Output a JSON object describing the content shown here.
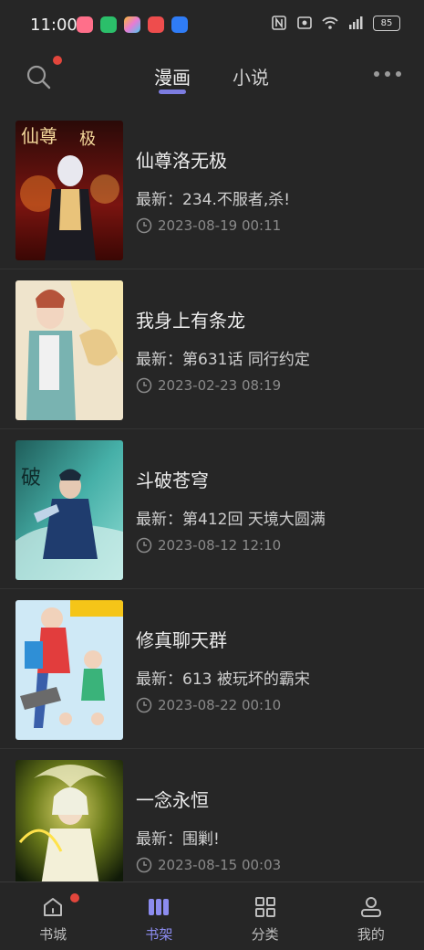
{
  "status_bar": {
    "time": "11:00",
    "battery": "85",
    "network": "5G",
    "app_icons": [
      {
        "name": "app-bilibili-icon",
        "color": "#ff6f8a"
      },
      {
        "name": "app-chat-icon",
        "color": "#2bbf6a"
      },
      {
        "name": "app-photos-icon",
        "color": "#e77bd4"
      },
      {
        "name": "app-red-icon",
        "color": "#ee4d4d"
      },
      {
        "name": "app-blue-icon",
        "color": "#2f7cf6"
      }
    ]
  },
  "top_bar": {
    "tabs": [
      {
        "label": "漫画",
        "active": true
      },
      {
        "label": "小说",
        "active": false
      }
    ]
  },
  "colors": {
    "accent": "#7c7ce0",
    "badge": "#e2463c",
    "background": "#262626"
  },
  "books": [
    {
      "title": "仙尊洛无极",
      "latest": "最新：234.不服者,杀!",
      "time": "2023-08-19 00:11"
    },
    {
      "title": "我身上有条龙",
      "latest": "最新：第631话 同行约定",
      "time": "2023-02-23 08:19"
    },
    {
      "title": "斗破苍穹",
      "latest": "最新：第412回 天境大圆满",
      "time": "2023-08-12 12:10"
    },
    {
      "title": "修真聊天群",
      "latest": "最新：613 被玩坏的霸宋",
      "time": "2023-08-22 00:10"
    },
    {
      "title": "一念永恒",
      "latest": "最新：围剿!",
      "time": "2023-08-15 00:03"
    }
  ],
  "bottom_nav": [
    {
      "label": "书城",
      "icon": "home-icon",
      "active": false,
      "badge": true
    },
    {
      "label": "书架",
      "icon": "bookshelf-icon",
      "active": true,
      "badge": false
    },
    {
      "label": "分类",
      "icon": "category-grid-icon",
      "active": false,
      "badge": false
    },
    {
      "label": "我的",
      "icon": "profile-icon",
      "active": false,
      "badge": false
    }
  ]
}
